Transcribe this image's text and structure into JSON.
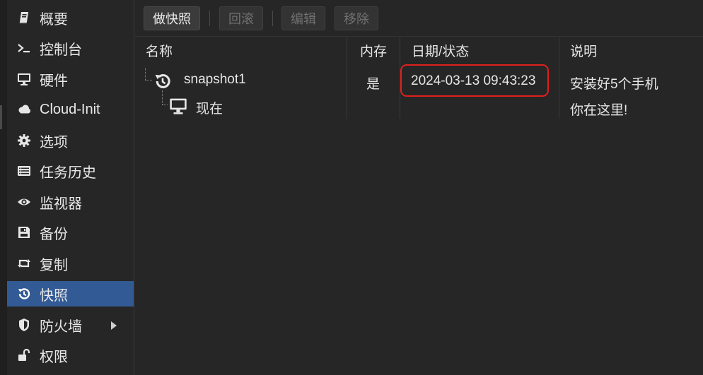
{
  "sidebar": {
    "items": [
      {
        "label": "概要",
        "icon": "book-icon"
      },
      {
        "label": "控制台",
        "icon": "terminal-icon"
      },
      {
        "label": "硬件",
        "icon": "monitor-icon"
      },
      {
        "label": "Cloud-Init",
        "icon": "cloud-icon"
      },
      {
        "label": "选项",
        "icon": "gear-icon"
      },
      {
        "label": "任务历史",
        "icon": "list-icon"
      },
      {
        "label": "监视器",
        "icon": "eye-icon"
      },
      {
        "label": "备份",
        "icon": "floppy-icon"
      },
      {
        "label": "复制",
        "icon": "retweet-icon"
      },
      {
        "label": "快照",
        "icon": "history-icon",
        "active": true
      },
      {
        "label": "防火墙",
        "icon": "shield-icon",
        "has_submenu": true
      },
      {
        "label": "权限",
        "icon": "unlock-icon"
      }
    ]
  },
  "toolbar": {
    "take_snapshot": "做快照",
    "rollback": "回滚",
    "edit": "编辑",
    "remove": "移除"
  },
  "table": {
    "columns": {
      "name": "名称",
      "ram": "内存",
      "date": "日期/状态",
      "description": "说明"
    },
    "rows": [
      {
        "name": "snapshot1",
        "icon": "history-icon",
        "ram": "是",
        "date": "2024-03-13 09:43:23",
        "description": "安装好5个手机"
      },
      {
        "name": "现在",
        "icon": "monitor-icon",
        "ram": "",
        "date": "",
        "description": "你在这里!"
      }
    ]
  },
  "colors": {
    "active_nav": "#325a94",
    "highlight_box": "#e0201c",
    "background": "#262626"
  }
}
